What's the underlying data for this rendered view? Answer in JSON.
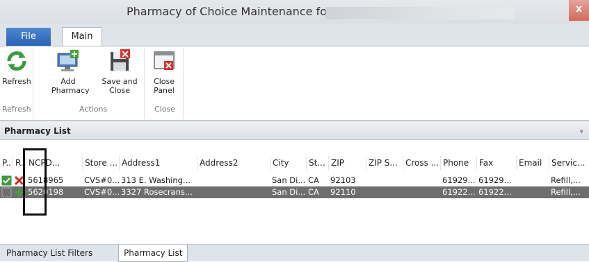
{
  "window": {
    "title": "Pharmacy of Choice Maintenance for",
    "close_label": "x"
  },
  "tabs": {
    "file": "File",
    "main": "Main"
  },
  "ribbon": {
    "refresh": "Refresh",
    "add_pharmacy_line1": "Add",
    "add_pharmacy_line2": "Pharmacy",
    "save_close_line1": "Save and",
    "save_close_line2": "Close",
    "close_panel_line1": "Close",
    "close_panel_line2": "Panel",
    "groups": {
      "refresh": "Refresh",
      "actions": "Actions",
      "close": "Close"
    }
  },
  "panel": {
    "title": "Pharmacy List",
    "pin": "ᵩ"
  },
  "grid": {
    "columns": [
      "P..",
      "R..",
      "NCPD...",
      "Store ...",
      "Address1",
      "Address2",
      "City",
      "St...",
      "ZIP",
      "ZIP S...",
      "Cross ...",
      "Phone",
      "Fax",
      "Email",
      "Servic..."
    ],
    "rows": [
      {
        "ncpdp": "5618965",
        "store": "CVS#0...",
        "address1": "313 E. Washing...",
        "address2": "",
        "city": "San Di...",
        "state": "CA",
        "zip": "92103",
        "zip_suffix": "",
        "cross": "",
        "phone": "61929...",
        "fax": "61929...",
        "email": "",
        "service": "Refill,..."
      },
      {
        "ncpdp": "5620198",
        "store": "CVS#0...",
        "address1": "3327 Rosecrans...",
        "address2": "",
        "city": "San Di...",
        "state": "CA",
        "zip": "92110",
        "zip_suffix": "",
        "cross": "",
        "phone": "61922...",
        "fax": "61922...",
        "email": "",
        "service": "Refill,..."
      }
    ]
  },
  "bottom_tabs": {
    "filters": "Pharmacy List Filters",
    "list": "Pharmacy List"
  },
  "colors": {
    "file_tab": "#2b63b4",
    "selected_row": "#6e6e6e",
    "remove_icon": "#d62a1e",
    "add_icon": "#3fa535",
    "check_icon": "#3c9a3c"
  }
}
